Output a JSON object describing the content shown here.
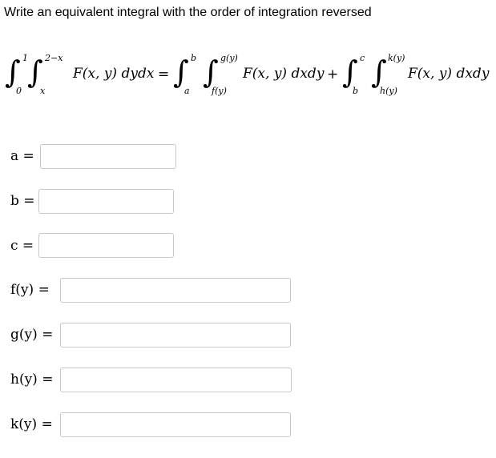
{
  "prompt": "Write an equivalent integral with the order of integration reversed",
  "equation": {
    "left_integral": {
      "outer_lower": "0",
      "outer_upper": "1",
      "inner_lower": "x",
      "inner_upper": "2−x",
      "integrand": "F(x, y) dydx"
    },
    "equals": "=",
    "right_integral_1": {
      "outer_lower": "a",
      "outer_upper": "b",
      "inner_lower": "f(y)",
      "inner_upper": "g(y)",
      "integrand": "F(x, y) dxdy"
    },
    "plus": "+",
    "right_integral_2": {
      "outer_lower": "b",
      "outer_upper": "c",
      "inner_lower": "h(y)",
      "inner_upper": "k(y)",
      "integrand": "F(x, y) dxdy"
    },
    "integral_symbol": "∫"
  },
  "fields": [
    {
      "label": "a =",
      "value": "",
      "placeholder": ""
    },
    {
      "label": "b =",
      "value": "",
      "placeholder": ""
    },
    {
      "label": "c =",
      "value": "",
      "placeholder": ""
    },
    {
      "label": "f(y) =",
      "value": "",
      "placeholder": ""
    },
    {
      "label": "g(y) =",
      "value": "",
      "placeholder": ""
    },
    {
      "label": "h(y) =",
      "value": "",
      "placeholder": ""
    },
    {
      "label": "k(y) =",
      "value": "",
      "placeholder": ""
    }
  ]
}
